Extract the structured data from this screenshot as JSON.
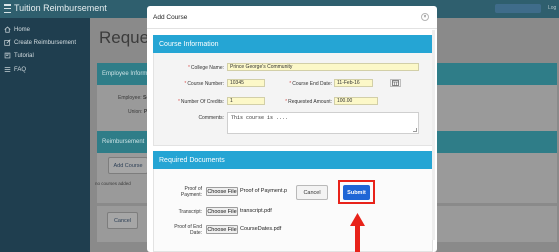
{
  "app": {
    "title": "Tuition Reimbursement",
    "logout_label": "Log",
    "colors": {
      "topbar": "#2f5f6e",
      "sidebar": "#1f3e4f",
      "accent": "#25a5d4",
      "submit": "#1f66d6",
      "highlight": "#e8231a"
    }
  },
  "sidebar": {
    "items": [
      {
        "icon": "home-icon",
        "label": "Home"
      },
      {
        "icon": "create-icon",
        "label": "Create Reimbursement"
      },
      {
        "icon": "tutorial-icon",
        "label": "Tutorial"
      },
      {
        "icon": "list-icon",
        "label": "FAQ"
      }
    ]
  },
  "page": {
    "title": "Request",
    "employee_panel_title": "Employee Inform",
    "employee_label": "Employee:",
    "employee_value": "Se",
    "union_label": "Union:",
    "union_value": "PC",
    "reimbursement_panel_title": "Reimbursement",
    "add_course_label": "Add Course",
    "no_courses_label": "no courses added",
    "cancel_label": "Cancel"
  },
  "modal": {
    "title": "Add Course",
    "close_glyph": "×",
    "course_section_title": "Course Information",
    "fields": {
      "college_name": {
        "label": "College Name:",
        "value": "Prince George's Community"
      },
      "course_number": {
        "label": "Course Number:",
        "value": "10345"
      },
      "course_end_date": {
        "label": "Course End Date:",
        "value": "11-Feb-16"
      },
      "credits": {
        "label": "Number Of Credits:",
        "value": "1"
      },
      "requested_amount": {
        "label": "Requested Amount:",
        "value": "100.00"
      },
      "comments": {
        "label": "Comments:",
        "value": "This course is ...."
      }
    },
    "documents_section_title": "Required Documents",
    "documents": {
      "proof_of_payment": {
        "label": "Proof of Payment:",
        "button": "Choose File",
        "file": "Proof of Payment.p"
      },
      "transcript": {
        "label": "Transcript:",
        "button": "Choose File",
        "file": "transcript.pdf"
      },
      "proof_of_end_date": {
        "label": "Proof of End Date:",
        "button": "Choose File",
        "file": "CourseDates.pdf"
      }
    },
    "cancel_label": "Cancel",
    "submit_label": "Submit"
  }
}
